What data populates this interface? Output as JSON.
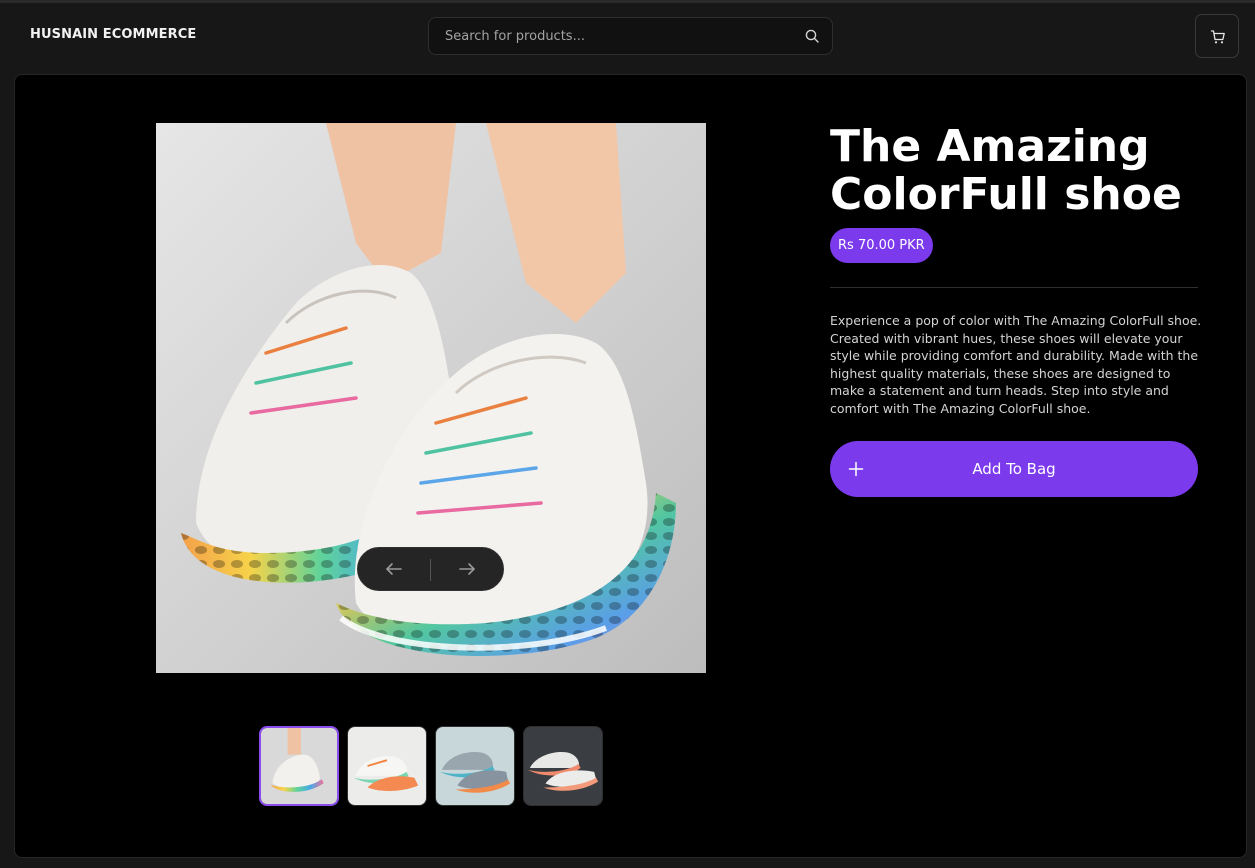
{
  "navbar": {
    "brand": "HUSNAIN ECOMMERCE",
    "search_placeholder": "Search for products...",
    "search_icon": "search-icon",
    "cart_icon": "cart-icon"
  },
  "gallery": {
    "prev_icon": "arrow-left-icon",
    "next_icon": "arrow-right-icon",
    "thumbnails_count": 4,
    "active_index": 0
  },
  "product": {
    "title": "The Amazing ColorFull shoe",
    "price": "Rs 70.00 PKR",
    "description": "Experience a pop of color with The Amazing ColorFull shoe. Created with vibrant hues, these shoes will elevate your style while providing comfort and durability. Made with the highest quality materials, these shoes are designed to make a statement and turn heads. Step into style and comfort with The Amazing ColorFull shoe.",
    "add_to_bag": "Add To Bag",
    "add_icon": "plus-icon"
  },
  "colors": {
    "accent": "#7c3aed",
    "background": "#171717",
    "panel": "#000000"
  }
}
